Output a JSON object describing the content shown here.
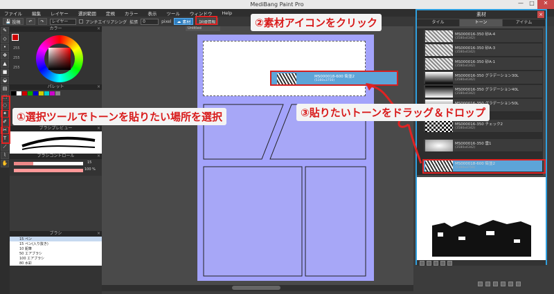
{
  "app": {
    "title": "MediBang Paint Pro"
  },
  "menu": [
    "ファイル",
    "編集",
    "レイヤー",
    "選択範囲",
    "定規",
    "カラー",
    "表示",
    "ツール",
    "ウィンドウ",
    "Help"
  ],
  "toolbar": {
    "save_label": "投稿",
    "layer_label": "レイヤー",
    "antialias_label": "アンチエイリアシング",
    "expand_label": "拡張",
    "expand_value": "0",
    "pixel_label": "pixel",
    "material_label": "素材",
    "snap_label": "詳細情報"
  },
  "canvas": {
    "tab": "Untitled"
  },
  "left": {
    "color_title": "カラー",
    "hsv_values": [
      "255",
      "255",
      "255"
    ],
    "palette_title": "パレット",
    "brush_preview_title": "ブラシプレビュー",
    "brush_control_title": "ブラシコントロール",
    "brush_size": "15",
    "brush_opacity": "100 %",
    "brush_title": "ブラシ",
    "brushes": [
      {
        "size": "15",
        "name": "ペン"
      },
      {
        "size": "15",
        "name": "ペン(入り抜き)"
      },
      {
        "size": "10",
        "name": "鉛筆"
      },
      {
        "size": "50",
        "name": "エアブラシ"
      },
      {
        "size": "100",
        "name": "エアブラシ"
      },
      {
        "size": "80",
        "name": "水彩"
      }
    ]
  },
  "materials": {
    "title": "素材",
    "tabs": [
      "タイル",
      "トーン",
      "アイテム"
    ],
    "items": [
      {
        "name": "MS000016-350 砂A-4",
        "size": "(3580x4342)"
      },
      {
        "name": "MS000016-350 砂A-3",
        "size": "(3580x4342)"
      },
      {
        "name": "MS000016-350 砂A-1",
        "size": "(3580x4342)"
      },
      {
        "name": "MS000016-350 グラデーション30L",
        "size": "(3580x4342)"
      },
      {
        "name": "MS000016-350 グラデーション40L",
        "size": "(3580x4342)"
      },
      {
        "name": "MS000016-350 グラデーション50L",
        "size": "(3580x4342)"
      },
      {
        "name": "MS000016-350 チェック2",
        "size": "(3580x4342)"
      },
      {
        "name": "MS000016-350 雲1",
        "size": "(3580x4342)"
      },
      {
        "name": "MS000018-600 街並2",
        "size": "(5160x3750)"
      }
    ],
    "dragged": {
      "name": "MS000018-600 街並2",
      "size": "(5160x3750)"
    }
  },
  "callouts": {
    "step1": "①選択ツールでトーンを貼りたい場所を選択",
    "step2": "②素材アイコンをクリック",
    "step3": "③貼りたいトーンをドラッグ＆ドロップ"
  },
  "colors": {
    "accent": "#2fa0e0",
    "callout_red": "#d81a1a",
    "page": "#a3a3fb",
    "selected": "#5da4d8"
  }
}
